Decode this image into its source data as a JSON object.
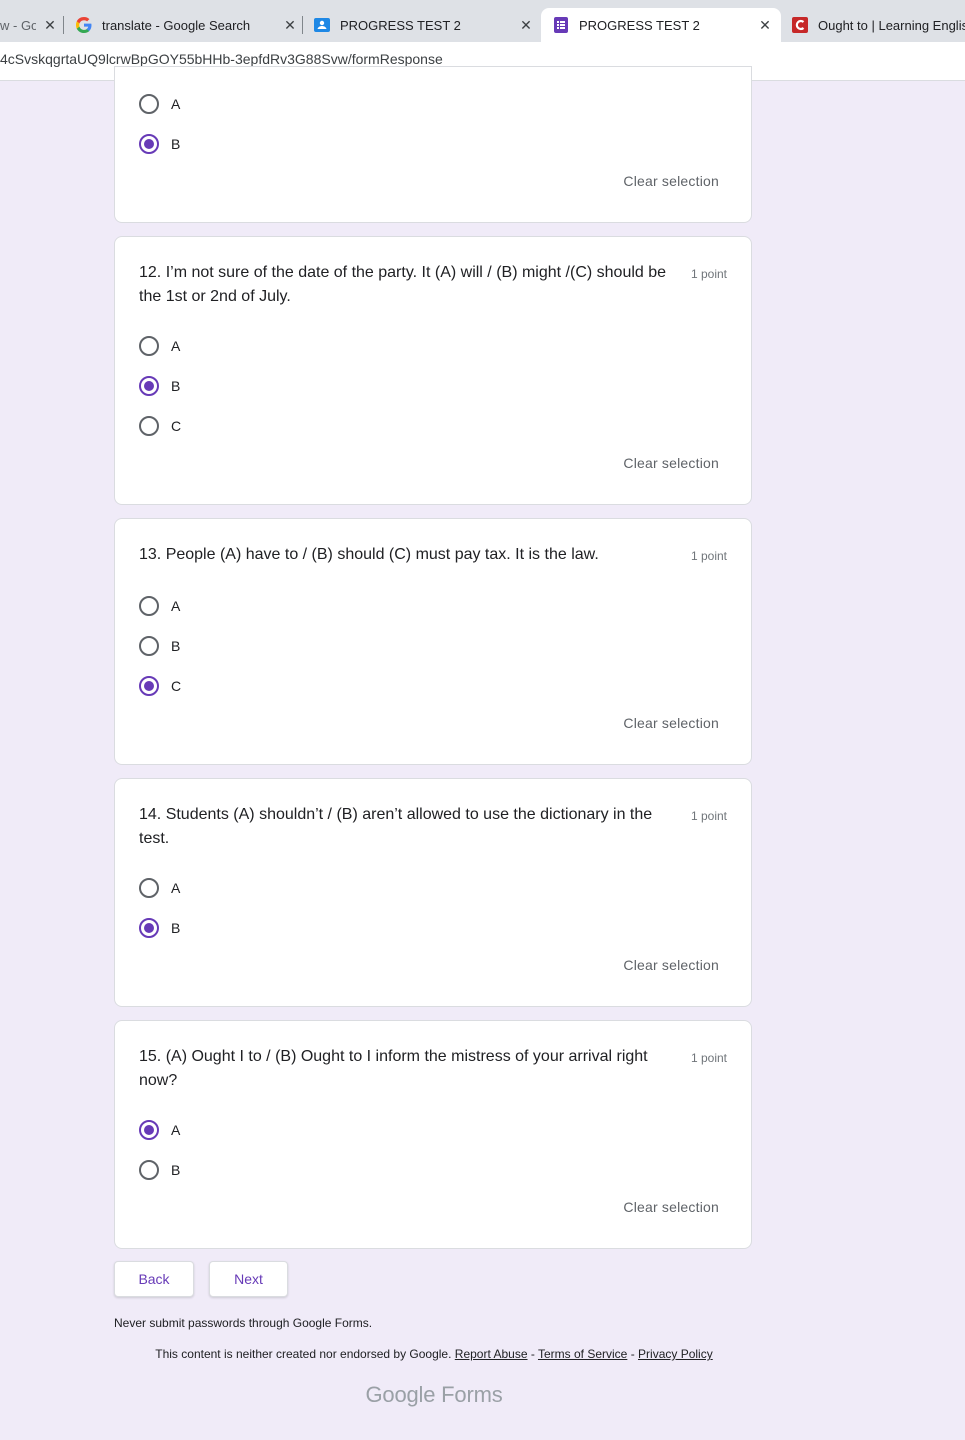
{
  "browser": {
    "tabs": [
      {
        "title": "w - Go",
        "active": false,
        "icon": "generic-page-icon"
      },
      {
        "title": "translate - Google Search",
        "active": false,
        "icon": "google-g-icon"
      },
      {
        "title": "PROGRESS TEST 2",
        "active": false,
        "icon": "classroom-icon"
      },
      {
        "title": "PROGRESS TEST 2",
        "active": true,
        "icon": "forms-icon"
      },
      {
        "title": "Ought to | Learning English",
        "active": false,
        "icon": "red-c-icon"
      }
    ],
    "close_glyph": "✕",
    "url": "4cSvskqgrtaUQ9lcrwBpGOY55bHHb-3epfdRv3G88Svw/formResponse"
  },
  "form": {
    "clear_label": "Clear selection",
    "accent_color": "#673ab7",
    "background_color": "#f0ebf8",
    "partial_question": {
      "options": [
        {
          "label": "A",
          "selected": false
        },
        {
          "label": "B",
          "selected": true
        }
      ]
    },
    "questions": [
      {
        "text": "12. I’m not sure of the date of the party. It (A) will / (B) might /(C) should be the 1st or 2nd of July.",
        "points": "1 point",
        "options": [
          {
            "label": "A",
            "selected": false
          },
          {
            "label": "B",
            "selected": true
          },
          {
            "label": "C",
            "selected": false
          }
        ]
      },
      {
        "text": "13. People (A) have to / (B) should (C) must pay tax. It is the law.",
        "points": "1 point",
        "options": [
          {
            "label": "A",
            "selected": false
          },
          {
            "label": "B",
            "selected": false
          },
          {
            "label": "C",
            "selected": true
          }
        ]
      },
      {
        "text": "14. Students (A) shouldn’t / (B) aren’t allowed to use the dictionary in the test.",
        "points": "1 point",
        "options": [
          {
            "label": "A",
            "selected": false
          },
          {
            "label": "B",
            "selected": true
          }
        ]
      },
      {
        "text": "15. (A) Ought I to / (B) Ought to I inform the mistress of your arrival right now?",
        "points": "1 point",
        "options": [
          {
            "label": "A",
            "selected": true
          },
          {
            "label": "B",
            "selected": false
          }
        ]
      }
    ],
    "back_label": "Back",
    "next_label": "Next"
  },
  "footer": {
    "warning": "Never submit passwords through Google Forms.",
    "disclaimer_prefix": "This content is neither created nor endorsed by Google.",
    "report_abuse": "Report Abuse",
    "sep": "-",
    "terms": "Terms of Service",
    "privacy": "Privacy Policy",
    "brand_google": "Google",
    "brand_forms": "Forms"
  }
}
